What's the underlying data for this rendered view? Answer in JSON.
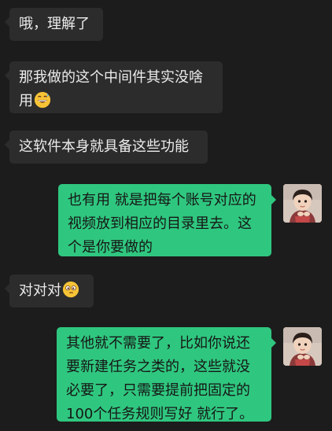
{
  "conversation": {
    "messages": [
      {
        "direction": "incoming",
        "text": "哦，理解了"
      },
      {
        "direction": "incoming",
        "text": "那我做的这个中间件其实没啥用",
        "emoji": "grin-sweat-emoji"
      },
      {
        "direction": "incoming",
        "text": "这软件本身就具备这些功能"
      },
      {
        "direction": "outgoing",
        "text": "也有用 就是把每个账号对应的视频放到相应的目录里去。这个是你要做的"
      },
      {
        "direction": "incoming",
        "text": "对对对",
        "emoji": "thinking-emoji"
      },
      {
        "direction": "outgoing",
        "text": "其他就不需要了，比如你说还要新建任务之类的，这些就没必要了，只需要提前把固定的100个任务规则写好 就行了。"
      }
    ]
  },
  "theme": {
    "background": "#1c1c1c",
    "incoming_bubble": "#2c2c2c",
    "outgoing_bubble": "#2fc77f",
    "incoming_text": "#ececec",
    "outgoing_text": "#161616"
  }
}
